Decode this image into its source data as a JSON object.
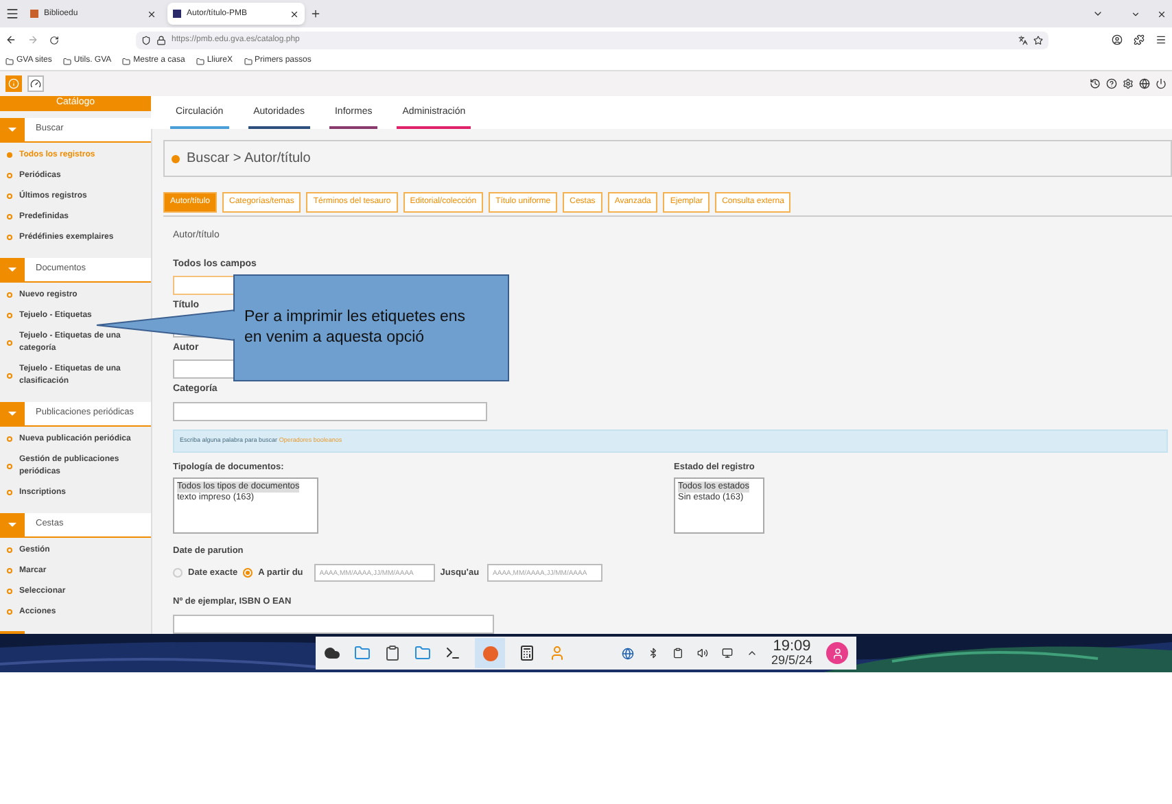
{
  "browser": {
    "tabs": [
      {
        "title": "Biblioedu",
        "selected": false
      },
      {
        "title": "Autor/título-PMB",
        "selected": true
      }
    ],
    "url": "https://pmb.edu.gva.es/catalog.php",
    "bookmarks": [
      "GVA sites",
      "Utils. GVA",
      "Mestre a casa",
      "LliureX",
      "Primers passos"
    ]
  },
  "sidebar": {
    "title": "Catálogo",
    "sections": [
      {
        "title": "Buscar",
        "items": [
          {
            "label": "Todos los registros",
            "selected": true
          },
          {
            "label": "Periódicas",
            "selected": false
          },
          {
            "label": "Últimos registros",
            "selected": false
          },
          {
            "label": "Predefinidas",
            "selected": false
          },
          {
            "label": "Prédéfinies exemplaires",
            "selected": false
          }
        ]
      },
      {
        "title": "Documentos",
        "items": [
          {
            "label": "Nuevo registro",
            "selected": false
          },
          {
            "label": "Tejuelo - Etiquetas",
            "selected": false
          },
          {
            "label": "Tejuelo - Etiquetas de una categoría",
            "selected": false
          },
          {
            "label": "Tejuelo - Etiquetas de una clasificación",
            "selected": false
          }
        ]
      },
      {
        "title": "Publicaciones periódicas",
        "items": [
          {
            "label": "Nueva publicación periódica",
            "selected": false
          },
          {
            "label": "Gestión de publicaciones periódicas",
            "selected": false
          },
          {
            "label": "Inscriptions",
            "selected": false
          }
        ]
      },
      {
        "title": "Cestas",
        "items": [
          {
            "label": "Gestión",
            "selected": false
          },
          {
            "label": "Marcar",
            "selected": false
          },
          {
            "label": "Seleccionar",
            "selected": false
          },
          {
            "label": "Acciones",
            "selected": false
          }
        ]
      }
    ]
  },
  "top_nav": [
    {
      "label": "Circulación",
      "color": "#4a9fd8"
    },
    {
      "label": "Autoridades",
      "color": "#2f4f7f"
    },
    {
      "label": "Informes",
      "color": "#8b3a6e"
    },
    {
      "label": "Administración",
      "color": "#e0226a"
    }
  ],
  "breadcrumb": "Buscar > Autor/título",
  "search_tabs": [
    {
      "label": "Autor/título",
      "selected": true
    },
    {
      "label": "Categorías/temas",
      "selected": false
    },
    {
      "label": "Términos del tesauro",
      "selected": false
    },
    {
      "label": "Editorial/colección",
      "selected": false
    },
    {
      "label": "Título uniforme",
      "selected": false
    },
    {
      "label": "Cestas",
      "selected": false
    },
    {
      "label": "Avanzada",
      "selected": false
    },
    {
      "label": "Ejemplar",
      "selected": false
    },
    {
      "label": "Consulta externa",
      "selected": false
    }
  ],
  "form": {
    "title": "Autor/título",
    "fields": [
      {
        "label": "Todos los campos",
        "focused": true
      },
      {
        "label": "Título",
        "focused": false
      },
      {
        "label": "Autor",
        "focused": false
      },
      {
        "label": "Categoría",
        "focused": false
      }
    ],
    "hint": "Escriba alguna palabra para buscar",
    "hint_link": "Operadores booleanos",
    "lists": [
      {
        "label": "Tipología de documentos:",
        "options": [
          {
            "label": "Todos los tipos de documentos",
            "selected": true
          },
          {
            "label": "texto impreso (163)",
            "selected": false
          }
        ]
      },
      {
        "label": "Estado del registro",
        "options": [
          {
            "label": "Todos los estados",
            "selected": true
          },
          {
            "label": "Sin estado (163)",
            "selected": false
          }
        ]
      }
    ],
    "date": {
      "label": "Date de parution",
      "radios": [
        {
          "label": "Date exacte",
          "selected": false
        },
        {
          "label": "A partir du",
          "selected": true
        }
      ],
      "from_placeholder": "AAAA,MM/AAAA,JJ/MM/AAAA",
      "until_label": "Jusqu'au",
      "until_placeholder": "AAAA,MM/AAAA,JJ/MM/AAAA"
    },
    "isbn_label": "Nº de ejemplar, ISBN O EAN"
  },
  "callout": "Per a imprimir les etiquetes ens en venim a aquesta opció",
  "taskbar": {
    "time": "19:09",
    "date": "29/5/24"
  }
}
